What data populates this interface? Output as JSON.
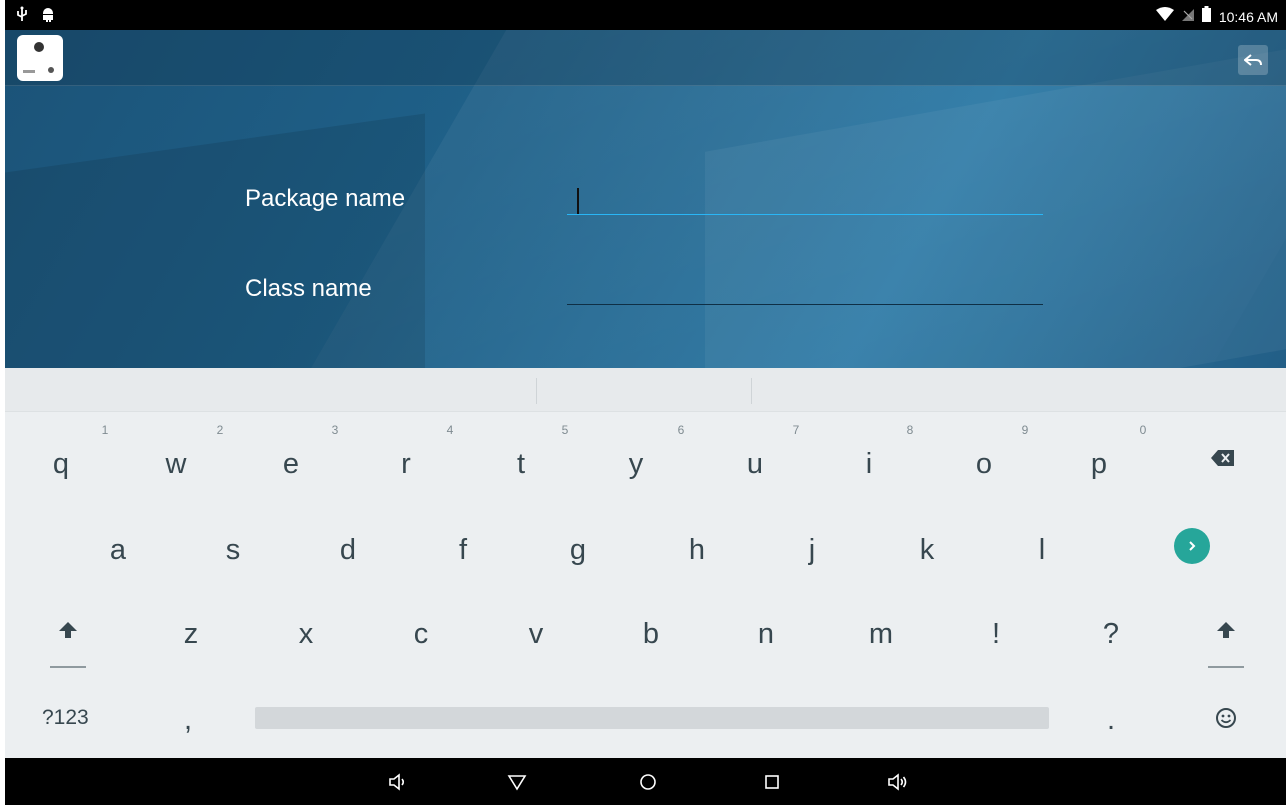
{
  "status_bar": {
    "time": "10:46 AM",
    "left_icons": [
      "usb-icon",
      "android-debug-icon"
    ],
    "right_icons": [
      "wifi-icon",
      "no-sim-icon",
      "battery-icon"
    ]
  },
  "toolbar": {
    "app_icon": "camera-app-icon",
    "back_icon": "back-arrow-icon"
  },
  "form": {
    "package_label": "Package name",
    "package_value": "",
    "class_label": "Class name",
    "class_value": "",
    "active_underline_color": "#29b6f6"
  },
  "keyboard": {
    "row1": [
      {
        "key": "q",
        "hint": "1"
      },
      {
        "key": "w",
        "hint": "2"
      },
      {
        "key": "e",
        "hint": "3"
      },
      {
        "key": "r",
        "hint": "4"
      },
      {
        "key": "t",
        "hint": "5"
      },
      {
        "key": "y",
        "hint": "6"
      },
      {
        "key": "u",
        "hint": "7"
      },
      {
        "key": "i",
        "hint": "8"
      },
      {
        "key": "o",
        "hint": "9"
      },
      {
        "key": "p",
        "hint": "0"
      }
    ],
    "row2": [
      "a",
      "s",
      "d",
      "f",
      "g",
      "h",
      "j",
      "k",
      "l"
    ],
    "row3": [
      "z",
      "x",
      "c",
      "v",
      "b",
      "n",
      "m",
      "!",
      "?"
    ],
    "symbols_label": "?123",
    "comma": ",",
    "period": ".",
    "enter_color": "#26a69a",
    "icons": [
      "backspace-icon",
      "enter-next-icon",
      "shift-icon",
      "emoji-icon"
    ]
  },
  "nav_bar": {
    "icons": [
      "volume-down-icon",
      "back-icon",
      "home-icon",
      "recents-icon",
      "volume-up-icon"
    ]
  }
}
